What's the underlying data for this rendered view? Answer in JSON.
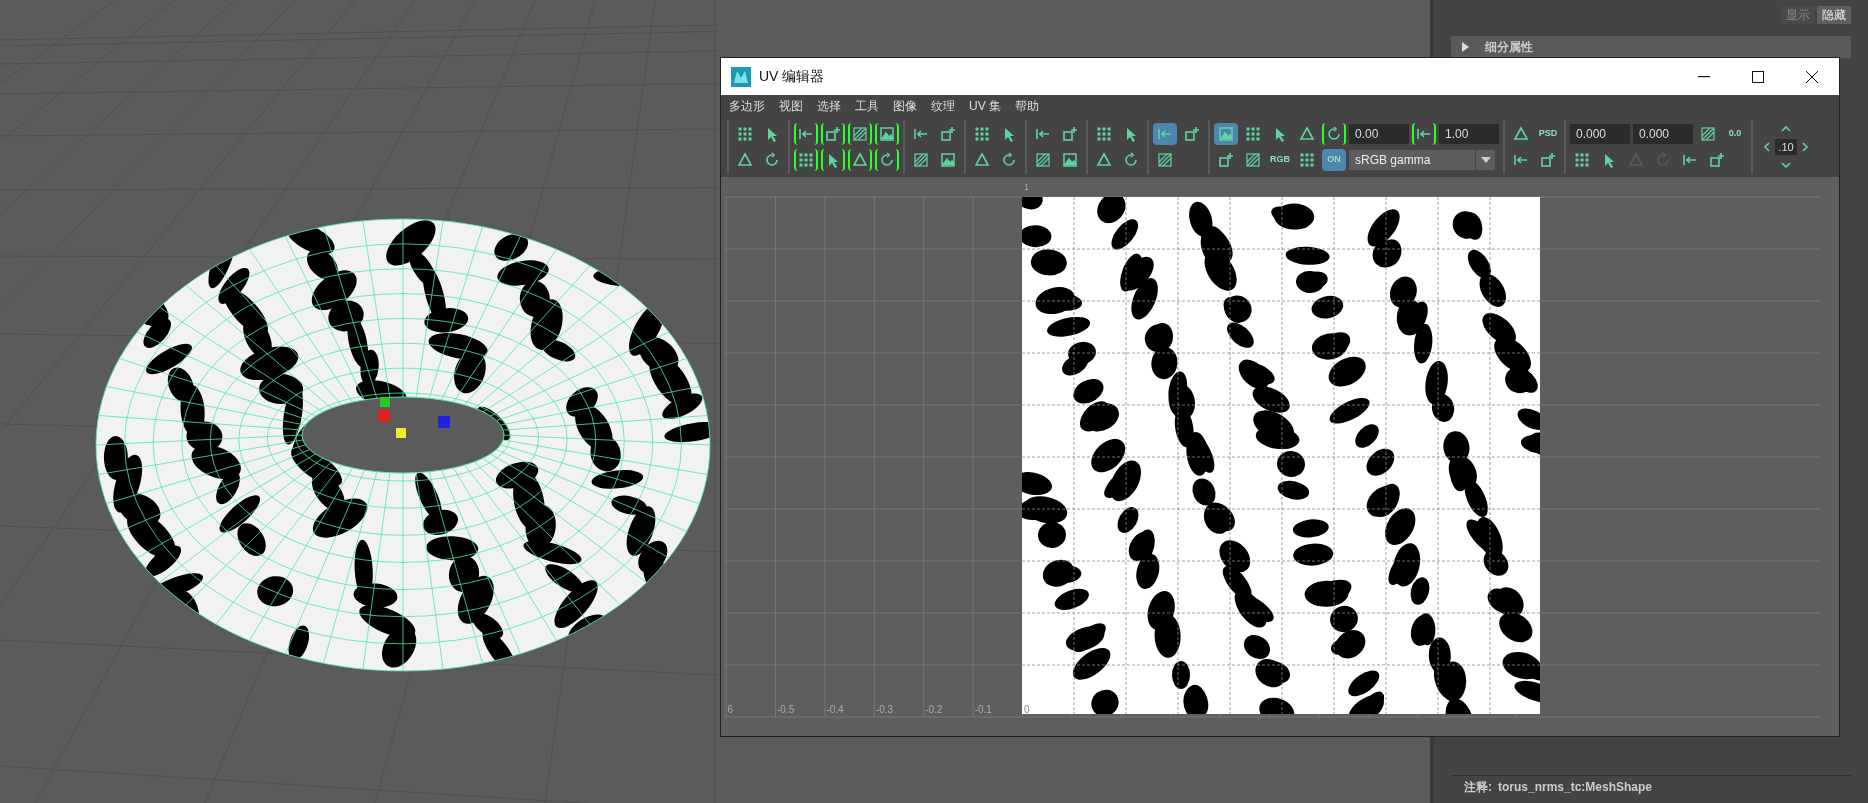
{
  "attribute_panel": {
    "buttons": [
      {
        "label": "显示",
        "selected": false
      },
      {
        "label": "隐藏",
        "selected": true
      }
    ],
    "sections": [
      {
        "title": "细分属性",
        "expanded": false
      }
    ],
    "note_label": "注释:",
    "note_value": "torus_nrms_tc:MeshShape"
  },
  "uv_editor": {
    "title": "UV 编辑器",
    "menu": [
      "多边形",
      "视图",
      "选择",
      "工具",
      "图像",
      "纹理",
      "UV 集",
      "帮助"
    ],
    "toolbar": [
      {
        "rows": [
          [
            {
              "kind": "tool",
              "on": false,
              "disabled": false
            },
            {
              "kind": "tool",
              "on": false,
              "disabled": false
            }
          ],
          [
            {
              "kind": "tool",
              "on": false,
              "disabled": false
            },
            {
              "kind": "tool",
              "on": false,
              "disabled": false
            }
          ]
        ]
      },
      {
        "rows": [
          [
            {
              "kind": "bracket-tool",
              "on": false,
              "disabled": false
            },
            {
              "kind": "bracket-tool",
              "on": false,
              "disabled": false
            },
            {
              "kind": "bracket-tool",
              "on": false,
              "disabled": false
            },
            {
              "kind": "bracket-tool",
              "on": false,
              "disabled": false
            }
          ],
          [
            {
              "kind": "bracket-tool",
              "on": false,
              "disabled": false
            },
            {
              "kind": "bracket-tool",
              "on": false,
              "disabled": false
            },
            {
              "kind": "bracket-tool",
              "on": false,
              "disabled": false
            },
            {
              "kind": "bracket-tool",
              "on": false,
              "disabled": false
            }
          ]
        ]
      },
      {
        "rows": [
          [
            {
              "kind": "tool",
              "on": false,
              "disabled": false
            },
            {
              "kind": "tool",
              "on": false,
              "disabled": false
            }
          ],
          [
            {
              "kind": "tool",
              "on": false,
              "disabled": false
            },
            {
              "kind": "tool",
              "on": false,
              "disabled": false
            }
          ]
        ]
      },
      {
        "rows": [
          [
            {
              "kind": "tool",
              "on": false,
              "disabled": false
            },
            {
              "kind": "tool",
              "on": false,
              "disabled": false
            }
          ],
          [
            {
              "kind": "tool",
              "on": false,
              "disabled": false
            },
            {
              "kind": "tool",
              "on": false,
              "disabled": false
            }
          ]
        ]
      },
      {
        "rows": [
          [
            {
              "kind": "tool",
              "on": false,
              "disabled": false
            },
            {
              "kind": "tool",
              "on": false,
              "disabled": false
            }
          ],
          [
            {
              "kind": "tool",
              "on": false,
              "disabled": false
            },
            {
              "kind": "tool",
              "on": false,
              "disabled": false
            }
          ]
        ]
      },
      {
        "rows": [
          [
            {
              "kind": "tool",
              "on": false,
              "disabled": false
            },
            {
              "kind": "tool",
              "on": false,
              "disabled": false
            }
          ],
          [
            {
              "kind": "tool",
              "on": false,
              "disabled": false
            },
            {
              "kind": "tool",
              "on": false,
              "disabled": false
            }
          ]
        ]
      },
      {
        "rows": [
          [
            {
              "kind": "tool",
              "on": true,
              "disabled": false
            },
            {
              "kind": "tool",
              "on": false,
              "disabled": false
            }
          ],
          [
            {
              "kind": "tool",
              "on": false,
              "disabled": false
            }
          ]
        ]
      },
      {
        "rows": [
          [
            {
              "kind": "tool",
              "on": true,
              "disabled": false
            },
            {
              "kind": "tool",
              "on": false,
              "disabled": false
            },
            {
              "kind": "tool",
              "on": false,
              "disabled": false
            },
            {
              "kind": "tool",
              "on": false,
              "disabled": false
            },
            {
              "kind": "bracket-tool",
              "on": false,
              "disabled": false
            },
            {
              "kind": "field",
              "value": "0.00"
            },
            {
              "kind": "bracket-tool",
              "on": false,
              "disabled": false
            },
            {
              "kind": "field",
              "value": "1.00"
            }
          ],
          [
            {
              "kind": "tool",
              "on": false,
              "disabled": false
            },
            {
              "kind": "tool",
              "on": false,
              "disabled": false
            },
            {
              "kind": "text-tool",
              "label": "RGB",
              "on": false,
              "disabled": false
            },
            {
              "kind": "tool",
              "on": false,
              "disabled": false
            },
            {
              "kind": "text-tool",
              "label": "ON",
              "on": true,
              "disabled": false
            },
            {
              "kind": "dropdown",
              "value": "sRGB gamma"
            }
          ]
        ]
      },
      {
        "rows": [
          [
            {
              "kind": "tool",
              "on": false,
              "disabled": false
            },
            {
              "kind": "text-tool",
              "label": "PSD",
              "on": false,
              "disabled": false
            }
          ],
          [
            {
              "kind": "tool",
              "on": false,
              "disabled": false
            },
            {
              "kind": "tool",
              "on": false,
              "disabled": false
            }
          ]
        ]
      },
      {
        "rows": [
          [
            {
              "kind": "field",
              "value": "0.000"
            },
            {
              "kind": "field",
              "value": "0.000"
            },
            {
              "kind": "tool",
              "on": false,
              "disabled": false
            },
            {
              "kind": "text-tool",
              "label": "0.0",
              "on": false,
              "disabled": false
            }
          ],
          [
            {
              "kind": "tool",
              "on": false,
              "disabled": false
            },
            {
              "kind": "tool",
              "on": false,
              "disabled": false
            },
            {
              "kind": "tool",
              "on": false,
              "disabled": true
            },
            {
              "kind": "tool",
              "on": false,
              "disabled": true
            },
            {
              "kind": "tool",
              "on": false,
              "disabled": false
            },
            {
              "kind": "tool",
              "on": false,
              "disabled": false
            }
          ]
        ]
      },
      {
        "rows": [
          [
            {
              "kind": "nav",
              "value": ".10"
            }
          ]
        ]
      }
    ],
    "canvas": {
      "top_label": "1",
      "axis_labels": [
        "6",
        "-0.5",
        "-0.4",
        "-0.3",
        "-0.2",
        "-0.1",
        "0"
      ]
    }
  }
}
